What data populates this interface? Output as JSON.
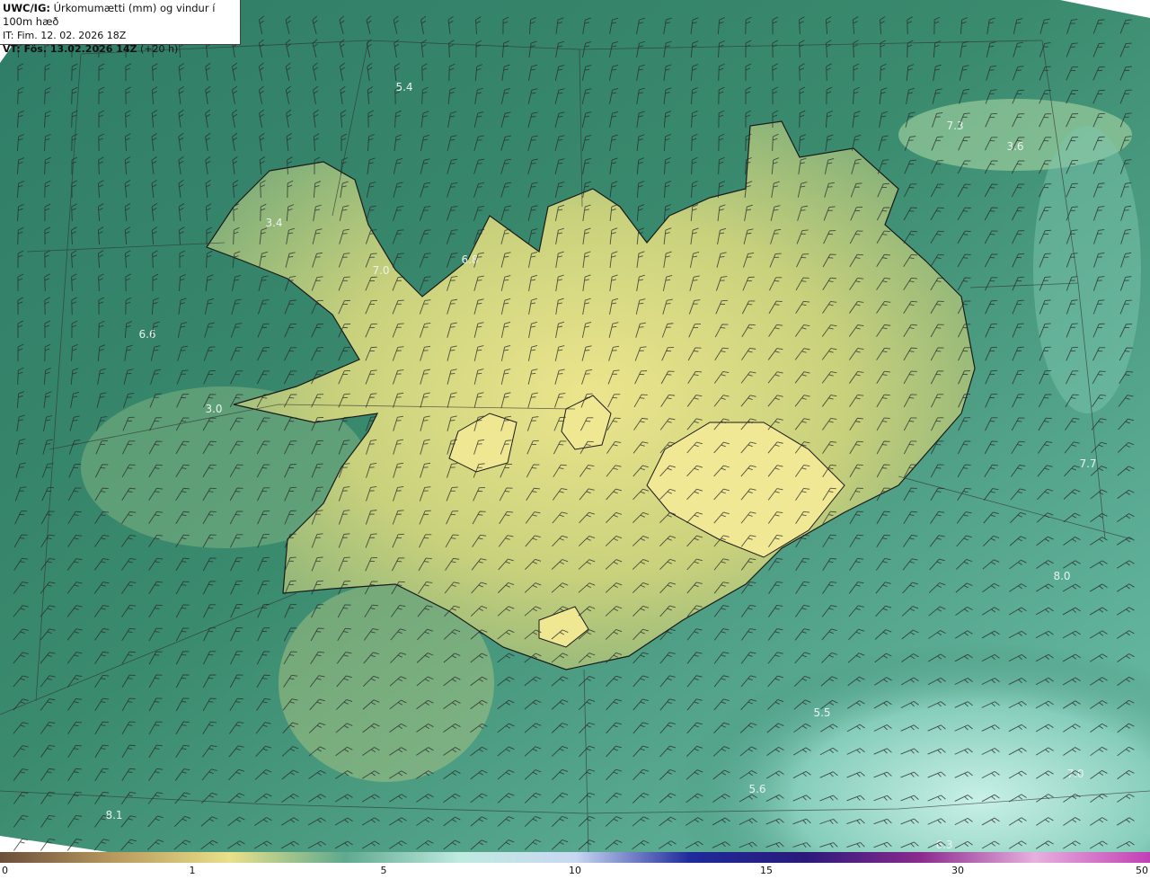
{
  "header": {
    "model_label": "UWC/IG:",
    "parameter": "Úrkomumætti (mm) og vindur í 100m hæð",
    "initial_time": "IT: Fim. 12. 02. 2026 18Z",
    "valid_label": "VT: Fös. 13.02.2026 14Z",
    "lead_time": "(+20 h)"
  },
  "map": {
    "region": "Iceland",
    "value_labels": [
      "5.4",
      "7.3",
      "3.6",
      "3.4",
      "6.8",
      "7.0",
      "6.6",
      "3.0",
      "7.7",
      "8.0",
      "5.5",
      "5.6",
      "7.0",
      "8.1",
      "6.3"
    ],
    "colors": {
      "land_low": "#e8e48c",
      "land_mid": "#a9bf6f",
      "sea_mid": "#3d8a70",
      "sea_light": "#79c6b4",
      "sea_pale": "#bfeae0",
      "coastline": "#1a1a1a",
      "wind_barb": "#2a2a2a"
    }
  },
  "colorbar": {
    "ticks": [
      "0",
      "1",
      "5",
      "10",
      "15",
      "30",
      "50"
    ],
    "colors": [
      "#6b4f3a",
      "#b99a5e",
      "#e8e08a",
      "#5fa98f",
      "#bfeae0",
      "#c9d8f2",
      "#1f2a9b",
      "#2a1a7a",
      "#8b2a8e",
      "#e7b0de",
      "#c23fb5"
    ]
  }
}
